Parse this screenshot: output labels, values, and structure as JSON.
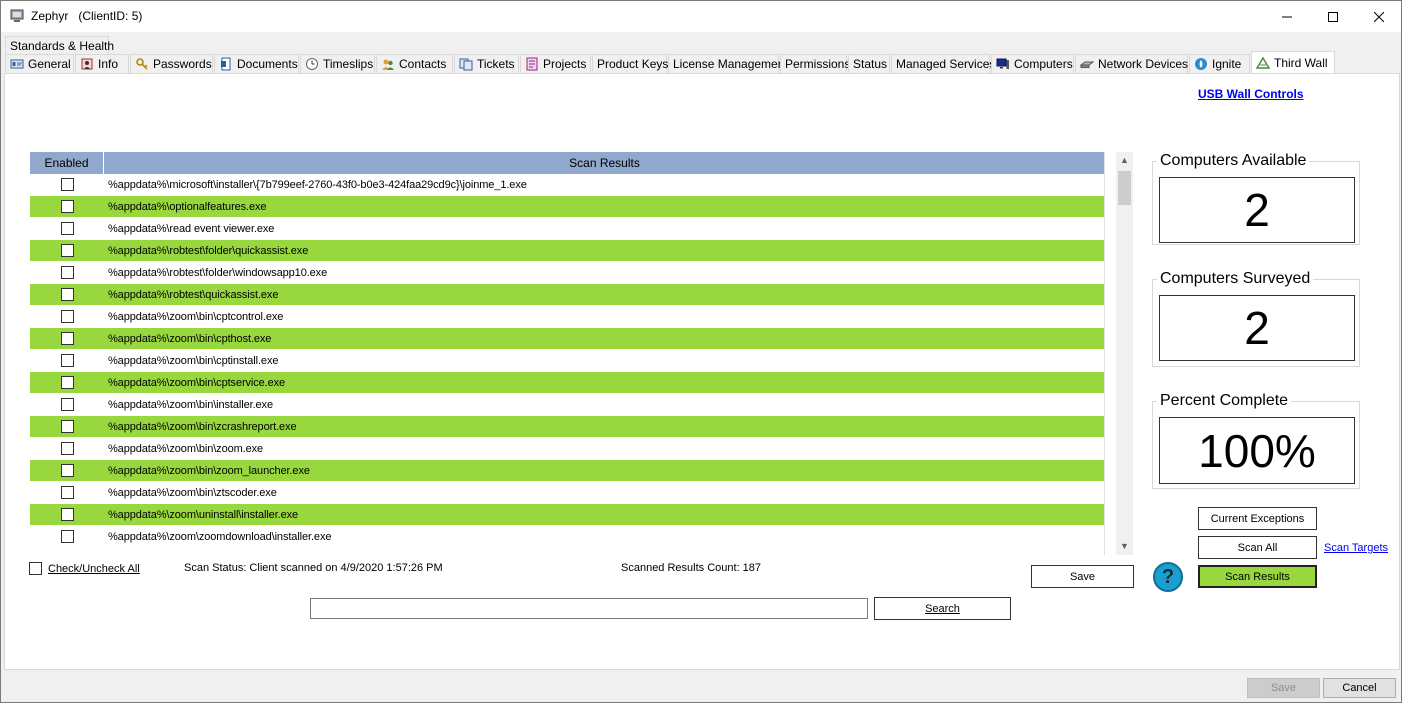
{
  "window": {
    "title": "Zephyr   (ClientID: 5)"
  },
  "tabs_row1": [
    {
      "label": "Standards & Health"
    }
  ],
  "tabs": [
    {
      "label": "General",
      "icon": "id-card-icon"
    },
    {
      "label": "Info",
      "icon": "info-icon"
    },
    {
      "label": "Passwords",
      "icon": "key-icon"
    },
    {
      "label": "Documents",
      "icon": "document-icon"
    },
    {
      "label": "Timeslips",
      "icon": "clock-icon"
    },
    {
      "label": "Contacts",
      "icon": "contacts-icon"
    },
    {
      "label": "Tickets",
      "icon": "tickets-icon"
    },
    {
      "label": "Projects",
      "icon": "projects-icon"
    },
    {
      "label": "Product Keys",
      "icon": ""
    },
    {
      "label": "License Management",
      "icon": ""
    },
    {
      "label": "Permissions",
      "icon": ""
    },
    {
      "label": "Status",
      "icon": ""
    },
    {
      "label": "Managed Services",
      "icon": ""
    },
    {
      "label": "Computers",
      "icon": "computer-icon"
    },
    {
      "label": "Network Devices",
      "icon": "network-device-icon"
    },
    {
      "label": "Ignite",
      "icon": "ignite-icon"
    },
    {
      "label": "Third Wall",
      "icon": "third-wall-icon"
    }
  ],
  "usb_wall_controls": "USB Wall Controls",
  "grid": {
    "col_enabled": "Enabled",
    "col_results": "Scan Results",
    "rows": [
      {
        "path": "%appdata%\\microsoft\\installer\\{7b799eef-2760-43f0-b0e3-424faa29cd9c}\\joinme_1.exe",
        "enabled": false
      },
      {
        "path": "%appdata%\\optionalfeatures.exe",
        "enabled": false
      },
      {
        "path": "%appdata%\\read event viewer.exe",
        "enabled": false
      },
      {
        "path": "%appdata%\\robtest\\folder\\quickassist.exe",
        "enabled": false
      },
      {
        "path": "%appdata%\\robtest\\folder\\windowsapp10.exe",
        "enabled": false
      },
      {
        "path": "%appdata%\\robtest\\quickassist.exe",
        "enabled": false
      },
      {
        "path": "%appdata%\\zoom\\bin\\cptcontrol.exe",
        "enabled": false
      },
      {
        "path": "%appdata%\\zoom\\bin\\cpthost.exe",
        "enabled": false
      },
      {
        "path": "%appdata%\\zoom\\bin\\cptinstall.exe",
        "enabled": false
      },
      {
        "path": "%appdata%\\zoom\\bin\\cptservice.exe",
        "enabled": false
      },
      {
        "path": "%appdata%\\zoom\\bin\\installer.exe",
        "enabled": false
      },
      {
        "path": "%appdata%\\zoom\\bin\\zcrashreport.exe",
        "enabled": false
      },
      {
        "path": "%appdata%\\zoom\\bin\\zoom.exe",
        "enabled": false
      },
      {
        "path": "%appdata%\\zoom\\bin\\zoom_launcher.exe",
        "enabled": false
      },
      {
        "path": "%appdata%\\zoom\\bin\\ztscoder.exe",
        "enabled": false
      },
      {
        "path": "%appdata%\\zoom\\uninstall\\installer.exe",
        "enabled": false
      },
      {
        "path": "%appdata%\\zoom\\zoomdownload\\installer.exe",
        "enabled": false
      }
    ]
  },
  "check_uncheck_all": "Check/Uncheck All",
  "scan_status": "Scan Status: Client scanned on 4/9/2020 1:57:26 PM",
  "scanned_results_count": "Scanned Results Count:  187",
  "save_label": "Save",
  "search": {
    "value": "",
    "button": "Search"
  },
  "stats": {
    "computers_available_label": "Computers Available",
    "computers_available": "2",
    "computers_surveyed_label": "Computers Surveyed",
    "computers_surveyed": "2",
    "percent_complete_label": "Percent Complete",
    "percent_complete": "100%"
  },
  "buttons": {
    "current_exceptions": "Current Exceptions",
    "scan_all": "Scan All",
    "scan_results": "Scan Results",
    "scan_targets": "Scan Targets"
  },
  "footer": {
    "save": "Save",
    "cancel": "Cancel"
  },
  "colors": {
    "row_alt": "#98d83e",
    "grid_header": "#8fa8cc",
    "link": "#0000ee",
    "help": "#1a9fd0"
  }
}
